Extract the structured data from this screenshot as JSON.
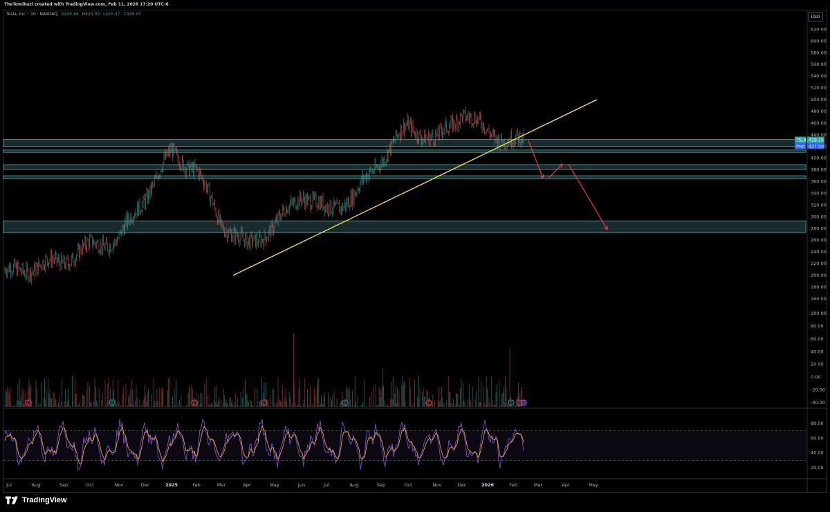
{
  "header": {
    "attribution": "TheTomikazi created with TradingView.com, Feb 11, 2026 17:20 UTC-6"
  },
  "legend": {
    "symbol_line": "Tesla, Inc. · 1h · NASDAQ",
    "open": "O425.84",
    "high": "H429.09",
    "low": "L425.47",
    "close": "C428.15"
  },
  "currency_button": "USD",
  "brand": "TradingView",
  "colors": {
    "background": "#000000",
    "candle_up": "#26a69a",
    "candle_down": "#ef5350",
    "trendline": "#ffeb3b",
    "forecast_arrow": "#f23645",
    "zone_fill": "#2f4f55",
    "zone_border": "#4b8f8c",
    "rsi_line": "#7e57c2",
    "rsi_signal": "#ffb74d"
  },
  "chart_data": [
    {
      "type": "candlestick",
      "symbol": "TSLA",
      "interval": "1h",
      "exchange": "NASDAQ",
      "ylim": [
        160,
        640
      ],
      "y_ticks": [
        620,
        600,
        580,
        560,
        540,
        520,
        500,
        480,
        460,
        440,
        420,
        400,
        380,
        360,
        340,
        320,
        300,
        280,
        260,
        240,
        220,
        200,
        180,
        160
      ],
      "x_ticks": [
        "Jul",
        "Aug",
        "Sep",
        "Oct",
        "Nov",
        "Dec",
        "2025",
        "Feb",
        "Mar",
        "Apr",
        "May",
        "Jun",
        "Jul",
        "Aug",
        "Sep",
        "Oct",
        "Nov",
        "Dec",
        "2026",
        "Feb",
        "Mar",
        "Apr",
        "May"
      ],
      "price_path": {
        "x": [
          "Jul",
          "Aug",
          "Sep",
          "Oct",
          "Nov",
          "Dec",
          "2025",
          "Feb",
          "Mar",
          "Apr",
          "May",
          "Jun",
          "Jul",
          "Aug",
          "Sep",
          "Oct",
          "Nov",
          "Dec",
          "2026",
          "Feb"
        ],
        "close": [
          205,
          215,
          225,
          250,
          262,
          335,
          410,
          380,
          290,
          250,
          285,
          340,
          310,
          335,
          400,
          455,
          430,
          480,
          445,
          428
        ]
      },
      "price_labels": [
        {
          "tag": "TSLA",
          "value": "428.15",
          "color": "#26a69a"
        },
        {
          "tag": "Post",
          "value": "427.50",
          "color": "#2962ff"
        }
      ],
      "zones": [
        {
          "low": 420,
          "high": 432
        },
        {
          "low": 410,
          "high": 414
        },
        {
          "low": 381,
          "high": 389
        },
        {
          "low": 365,
          "high": 370
        },
        {
          "low": 273,
          "high": 293
        }
      ],
      "trendline": {
        "x_start": "Mar",
        "y_start": 200,
        "x_end": "Mar 2026",
        "y_end": 500
      },
      "forecast_arrows": [
        {
          "from": 430,
          "to": 366
        },
        {
          "from": 366,
          "to": 390
        },
        {
          "from": 390,
          "to": 278
        }
      ],
      "event_markers": [
        "E",
        "E",
        "E",
        "E",
        "E",
        "E",
        "E",
        "E"
      ]
    },
    {
      "type": "bar",
      "name": "",
      "ylim": [
        -40,
        100
      ],
      "y_ticks": [
        100,
        80,
        60,
        40,
        20,
        0,
        -20,
        -40
      ]
    },
    {
      "type": "line",
      "name": "",
      "ylim": [
        0,
        100
      ],
      "y_ticks": [
        80,
        60,
        40,
        20
      ],
      "bands": [
        30,
        70
      ]
    }
  ]
}
